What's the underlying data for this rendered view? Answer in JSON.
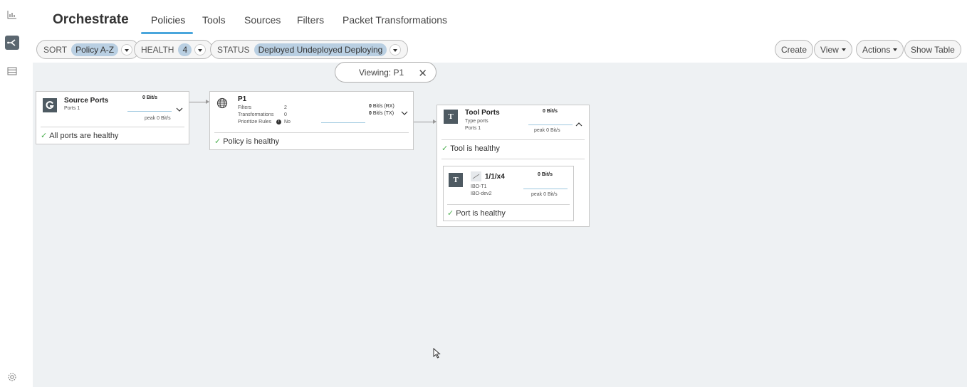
{
  "app": {
    "title": "Orchestrate"
  },
  "tabs": [
    {
      "label": "Policies",
      "active": true
    },
    {
      "label": "Tools"
    },
    {
      "label": "Sources"
    },
    {
      "label": "Filters"
    },
    {
      "label": "Packet Transformations"
    }
  ],
  "rail_icons": [
    "chart-icon",
    "orchestrate-icon",
    "list-icon",
    "settings-icon"
  ],
  "filters": {
    "sort_label": "SORT",
    "sort_value": "Policy A-Z",
    "health_label": "HEALTH",
    "health_value": "4",
    "status_label": "STATUS",
    "status_value": "Deployed Undeployed Deploying"
  },
  "actions": {
    "create": "Create",
    "view": "View",
    "actions": "Actions",
    "show_table": "Show Table"
  },
  "viewing": {
    "label": "Viewing: P1",
    "close": "✕"
  },
  "source_ports": {
    "title": "Source Ports",
    "ports": "Ports  1",
    "rate": "0 Bit/s",
    "peak": "peak 0 Bit/s",
    "health": "All ports are healthy"
  },
  "policy": {
    "title": "P1",
    "filters_label": "Filters",
    "filters_value": "2",
    "transformations_label": "Transformations",
    "transformations_value": "0",
    "prioritize_label": "Prioritize Rules",
    "prioritize_value": "No",
    "rx_value": "0",
    "rx_unit": "Bit/s (RX)",
    "tx_value": "0",
    "tx_unit": "Bit/s (TX)",
    "health": "Policy is healthy"
  },
  "tool_ports": {
    "title": "Tool Ports",
    "type": "Type  ports",
    "ports": "Ports  1",
    "rate": "0 Bit/s",
    "peak": "peak 0 Bit/s",
    "health": "Tool is healthy"
  },
  "port": {
    "title": "1/1/x4",
    "line1": "IBO-T1",
    "line2": "IBO-dev2",
    "rate": "0 Bit/s",
    "peak": "peak 0 Bit/s",
    "health": "Port is healthy"
  },
  "colors": {
    "accent": "#4aa6dc",
    "canvas": "#eef1f3",
    "chip": "#b9cfe2",
    "healthy": "#4caf50",
    "logo": "#4e5a62"
  }
}
